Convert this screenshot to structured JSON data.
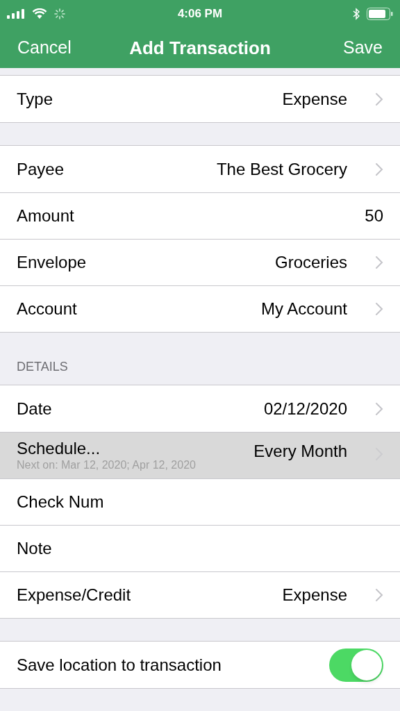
{
  "status_bar": {
    "time": "4:06 PM"
  },
  "nav_bar": {
    "left": "Cancel",
    "title": "Add Transaction",
    "right": "Save"
  },
  "sections": [
    {
      "rows": [
        {
          "kind": "disclosure",
          "label": "Type",
          "value": "Expense",
          "selected": false
        }
      ]
    },
    {
      "rows": [
        {
          "kind": "disclosure",
          "label": "Payee",
          "value": "The Best Grocery",
          "selected": false
        },
        {
          "kind": "plain",
          "label": "Amount",
          "value": "50",
          "selected": false
        },
        {
          "kind": "disclosure",
          "label": "Envelope",
          "value": "Groceries",
          "selected": false
        },
        {
          "kind": "disclosure",
          "label": "Account",
          "value": "My Account",
          "selected": false
        }
      ]
    },
    {
      "header": "DETAILS",
      "rows": [
        {
          "kind": "disclosure",
          "label": "Date",
          "value": "02/12/2020",
          "selected": false
        },
        {
          "kind": "disclosure",
          "label": "Schedule...",
          "value": "Every Month",
          "subtitle": "Next on: Mar 12, 2020; Apr 12, 2020",
          "selected": true
        },
        {
          "kind": "plain",
          "label": "Check Num",
          "selected": false
        },
        {
          "kind": "plain",
          "label": "Note",
          "selected": false
        },
        {
          "kind": "disclosure",
          "label": "Expense/Credit",
          "value": "Expense",
          "selected": false
        }
      ]
    },
    {
      "rows": [
        {
          "kind": "toggle",
          "label": "Save location to transaction",
          "on": true
        }
      ]
    }
  ]
}
